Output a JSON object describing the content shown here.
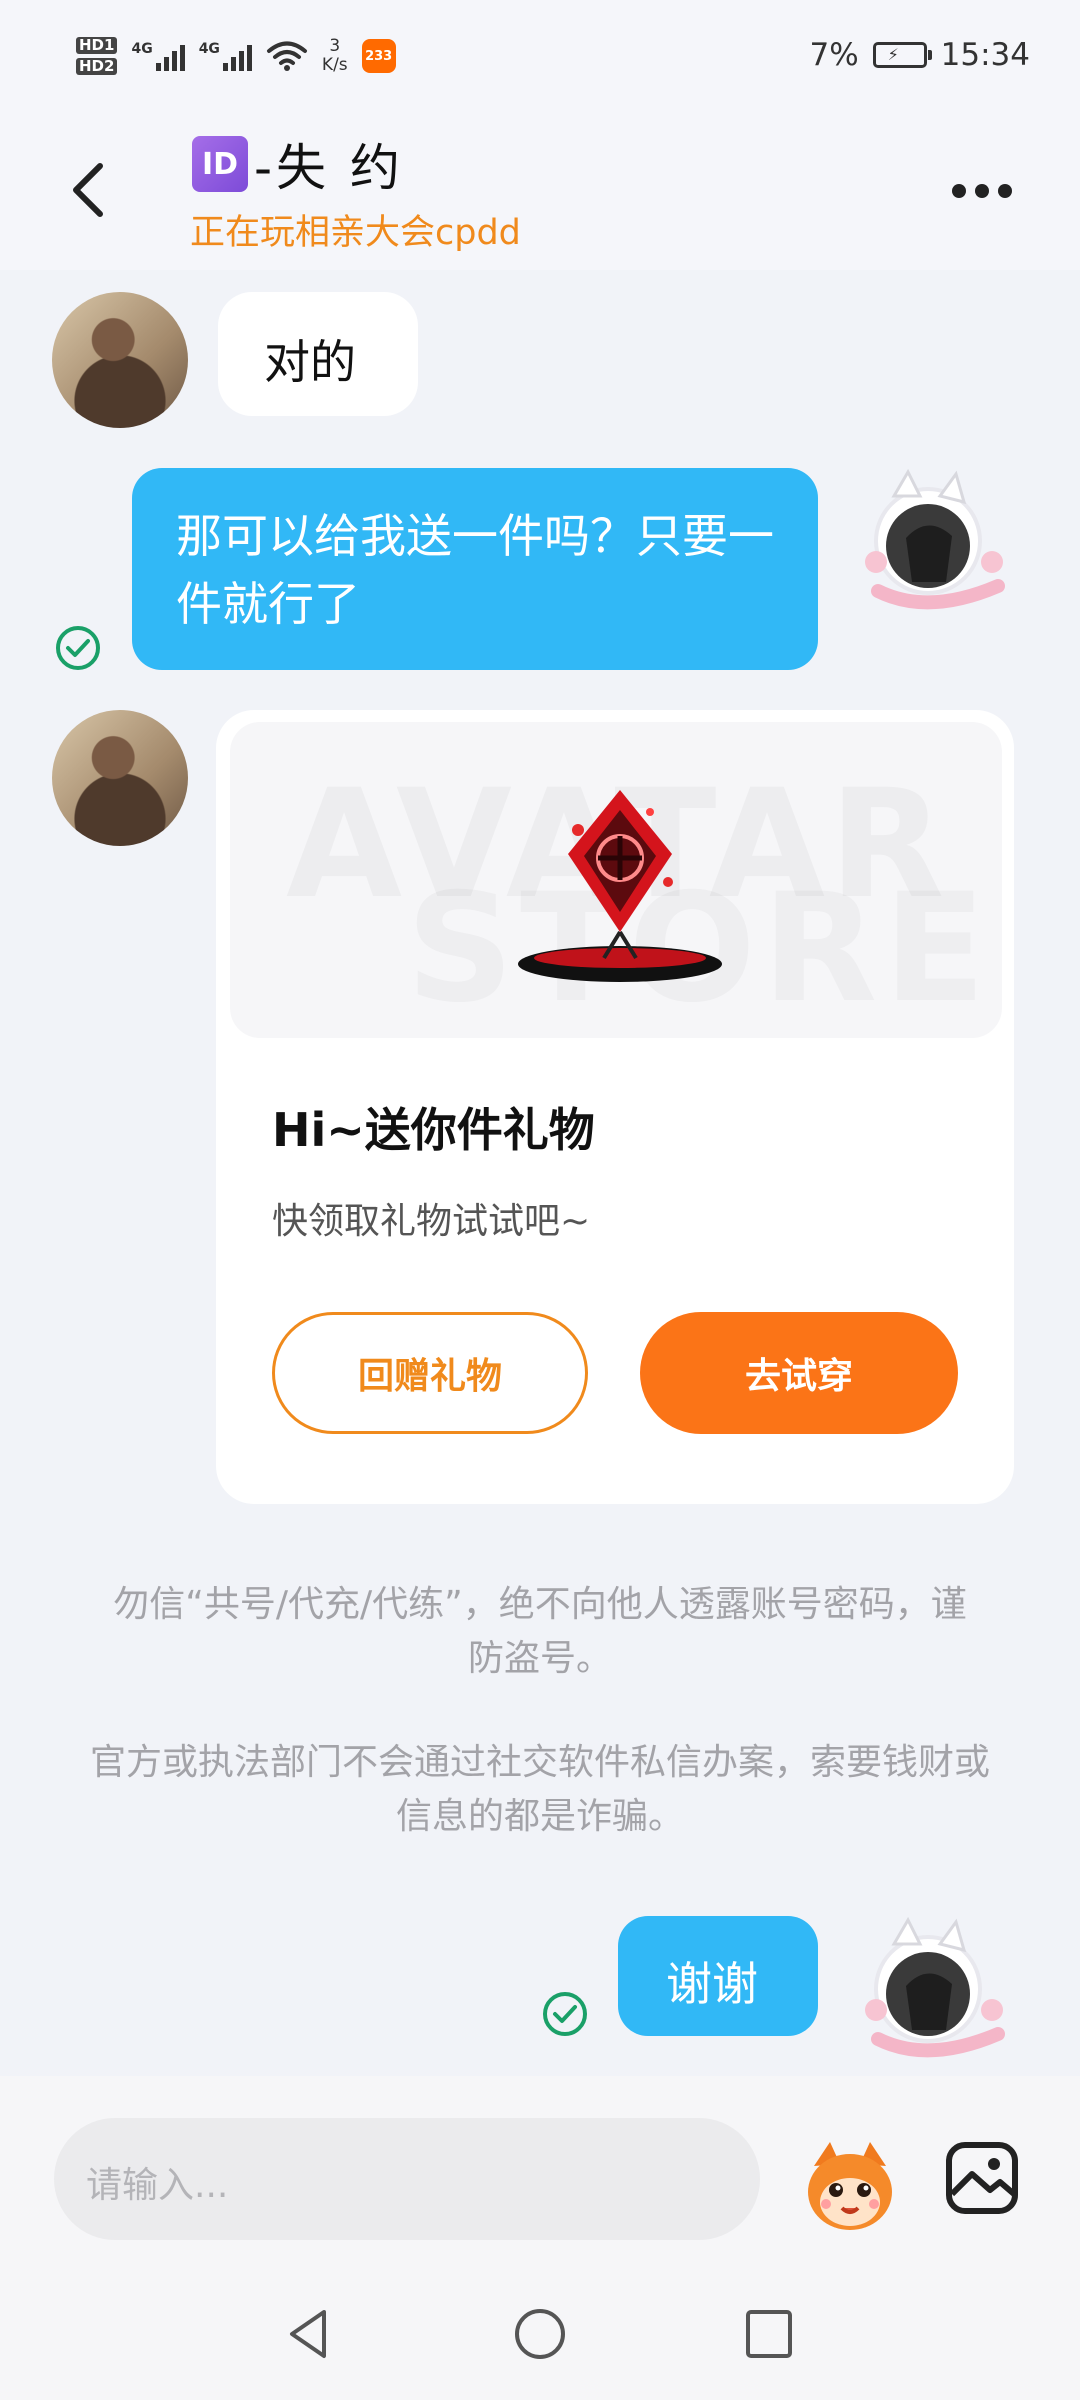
{
  "status_bar": {
    "hd1": "HD1",
    "hd2": "HD2",
    "sig1_label": "4G",
    "sig2_label": "4G",
    "net_speed_value": "3",
    "net_speed_unit": "K/s",
    "app_badge": "233",
    "battery": "7%",
    "time": "15:34"
  },
  "header": {
    "id_badge": "ID",
    "title": "-失 约",
    "subtitle": "正在玩相亲大会cpdd"
  },
  "messages": {
    "m1": "对的",
    "m2": "那可以给我送一件吗？只要一件就行了",
    "m3": "谢谢"
  },
  "gift_card": {
    "watermark1": "AVATAR",
    "watermark2": "STORE",
    "title": "Hi~送你件礼物",
    "subtitle": "快领取礼物试试吧~",
    "return_button": "回赠礼物",
    "try_button": "去试穿"
  },
  "notices": {
    "n1": "勿信“共号/代充/代练”，绝不向他人透露账号密码，谨防盗号。",
    "n2": "官方或执法部门不会通过社交软件私信办案，索要钱财或信息的都是诈骗。"
  },
  "input": {
    "placeholder": "请输入..."
  },
  "colors": {
    "accent_orange": "#fb7417",
    "subtitle_orange": "#f08a1c",
    "bubble_blue": "#31b8f6",
    "check_green": "#1aa068"
  }
}
